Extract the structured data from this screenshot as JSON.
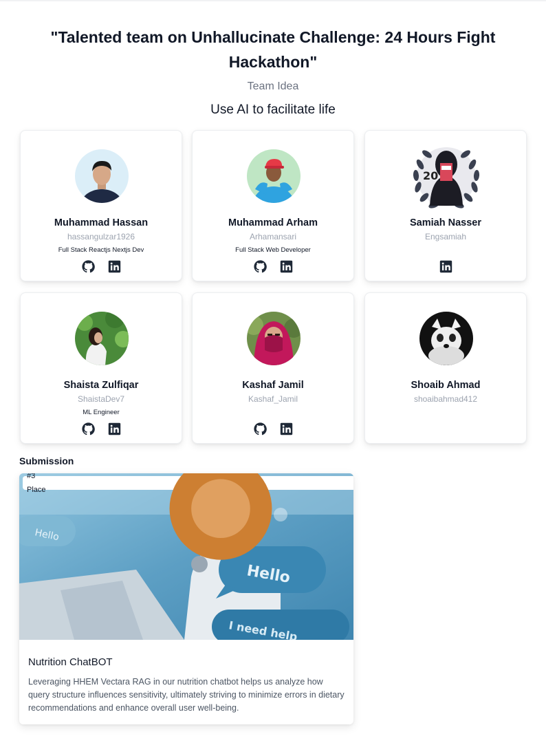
{
  "page": {
    "title": "\"Talented team on Unhallucinate Challenge: 24 Hours Fight Hackathon\"",
    "team_idea_label": "Team Idea",
    "team_idea": "Use AI to facilitate life"
  },
  "members": [
    {
      "name": "Muhammad Hassan",
      "handle": "hassangulzar1926",
      "role": "Full Stack Reactjs Nextjs Dev",
      "socials": [
        "github-icon",
        "linkedin-icon"
      ]
    },
    {
      "name": "Muhammad Arham",
      "handle": "Arhamansari",
      "role": "Full Stack Web Developer",
      "socials": [
        "github-icon",
        "linkedin-icon"
      ]
    },
    {
      "name": "Samiah Nasser",
      "handle": "Engsamiah",
      "role": "",
      "socials": [
        "linkedin-icon"
      ]
    },
    {
      "name": "Shaista Zulfiqar",
      "handle": "ShaistaDev7",
      "role": "ML Engineer",
      "socials": [
        "github-icon",
        "linkedin-icon"
      ]
    },
    {
      "name": "Kashaf Jamil",
      "handle": "Kashaf_Jamil",
      "role": "",
      "socials": [
        "github-icon",
        "linkedin-icon"
      ]
    },
    {
      "name": "Shoaib Ahmad",
      "handle": "shoaibahmad412",
      "role": "",
      "socials": []
    }
  ],
  "submission": {
    "section_label": "Submission",
    "badge": "#3 Place",
    "badge_icon": "bronze-medal-icon",
    "image_text": [
      "Hello",
      "Hello",
      "I need help"
    ],
    "title": "Nutrition ChatBOT",
    "description": "Leveraging HHEM Vectara RAG in our nutrition chatbot helps us analyze how query structure influences sensitivity, ultimately striving to minimize errors in dietary recommendations and enhance overall user well-being."
  },
  "colors": {
    "text_primary": "#111827",
    "text_muted": "#9ca3af",
    "text_secondary": "#4b5563",
    "icon": "#1f2937",
    "card_border": "#eceef1"
  }
}
